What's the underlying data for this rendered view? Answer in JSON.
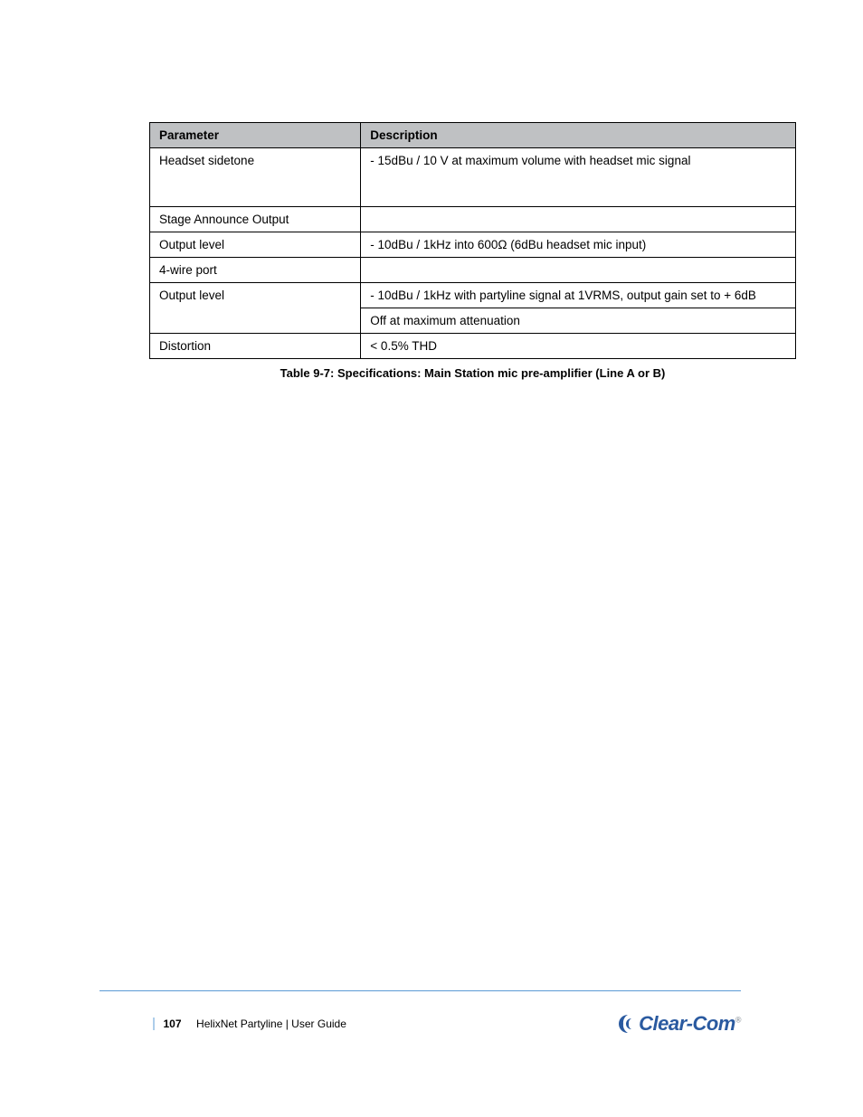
{
  "table": {
    "headers": {
      "param": "Parameter",
      "desc": "Description"
    },
    "rows": [
      {
        "param": "Headset sidetone",
        "desc": "- 15dBu / 10 V at maximum volume with headset mic signal"
      },
      {
        "param": "Stage Announce Output",
        "desc": ""
      },
      {
        "param": "Output level",
        "desc": "- 10dBu / 1kHz into 600Ω (6dBu headset mic input)"
      },
      {
        "param": "4-wire port",
        "desc": ""
      },
      {
        "param": "Output level",
        "desc": "- 10dBu / 1kHz with partyline signal at 1VRMS, output gain set to + 6dB"
      },
      {
        "param": null,
        "desc": "Off at maximum attenuation"
      },
      {
        "param": "Distortion",
        "desc": "< 0.5% THD"
      }
    ]
  },
  "caption": "Table 9-7: Specifications: Main Station mic pre-amplifier (Line A or B)",
  "footer": {
    "page_number": "107",
    "doc_title": "HelixNet Partyline | User Guide"
  },
  "logo_text": "Clear-Com"
}
